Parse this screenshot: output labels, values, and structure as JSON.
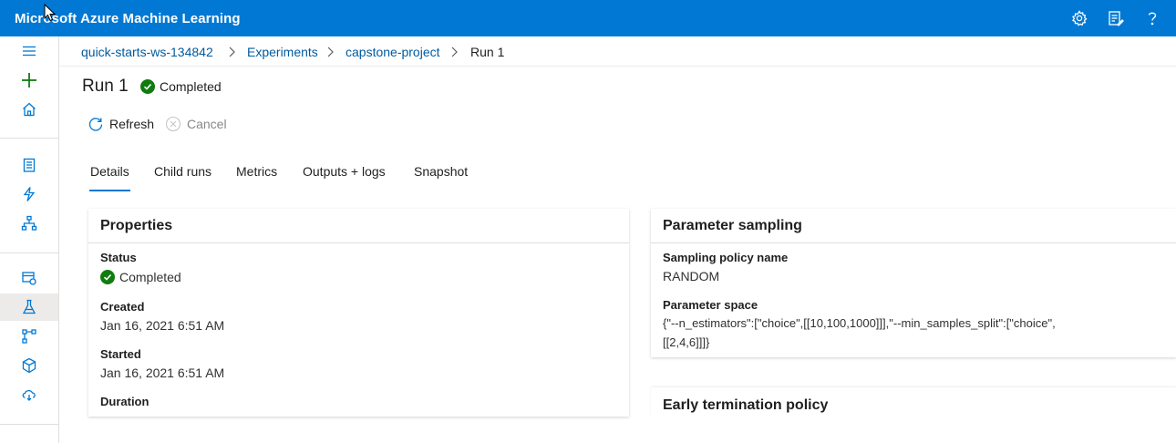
{
  "app": {
    "title": "Microsoft Azure Machine Learning"
  },
  "header_icons": [
    {
      "name": "settings-icon"
    },
    {
      "name": "feedback-icon"
    },
    {
      "name": "help-icon"
    }
  ],
  "nav": {
    "items": [
      "menu-icon",
      "add-icon",
      "home-icon",
      "notebooks-icon",
      "automl-icon",
      "designer-icon",
      "datasets-icon",
      "experiments-icon",
      "pipelines-icon",
      "models-icon",
      "endpoints-icon"
    ],
    "active": "experiments-icon"
  },
  "breadcrumb": {
    "workspace": "quick-starts-ws-134842",
    "experiments": "Experiments",
    "experiment": "capstone-project",
    "current": "Run 1"
  },
  "run": {
    "title": "Run 1",
    "status": "Completed",
    "status_color": "#107c10"
  },
  "commands": {
    "refresh": "Refresh",
    "cancel": "Cancel"
  },
  "tabs": [
    "Details",
    "Child runs",
    "Metrics",
    "Outputs + logs",
    "Snapshot"
  ],
  "active_tab": "Details",
  "properties": {
    "title": "Properties",
    "status_label": "Status",
    "status_value": "Completed",
    "created_label": "Created",
    "created_value": "Jan 16, 2021 6:51 AM",
    "started_label": "Started",
    "started_value": "Jan 16, 2021 6:51 AM",
    "duration_label": "Duration"
  },
  "sampling": {
    "title": "Parameter sampling",
    "policy_label": "Sampling policy name",
    "policy_value": "RANDOM",
    "space_label": "Parameter space",
    "space_line1": "{\"--n_estimators\":[\"choice\",[[10,100,1000]]],\"--min_samples_split\":[\"choice\",",
    "space_line2": "[[2,4,6]]]}"
  },
  "early_termination": {
    "title": "Early termination policy"
  },
  "colors": {
    "accent": "#0078d4",
    "link": "#005a9e",
    "success": "#107c10"
  }
}
